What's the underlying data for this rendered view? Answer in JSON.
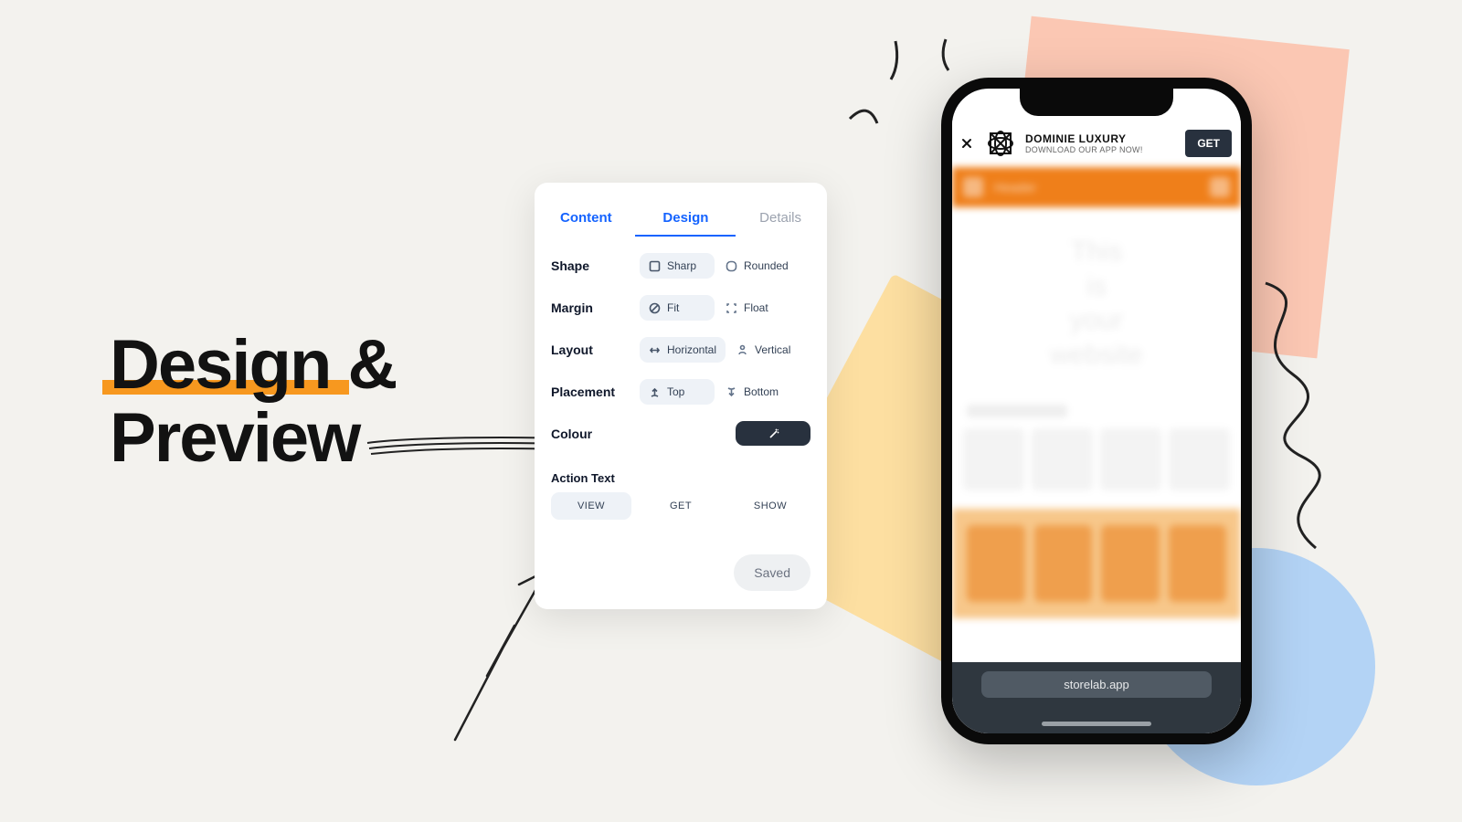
{
  "title": {
    "line1": "Design &",
    "line2": "Preview"
  },
  "panel": {
    "tabs": {
      "content": "Content",
      "design": "Design",
      "details": "Details"
    },
    "rows": {
      "shape": {
        "label": "Shape",
        "a": "Sharp",
        "b": "Rounded"
      },
      "margin": {
        "label": "Margin",
        "a": "Fit",
        "b": "Float"
      },
      "layout": {
        "label": "Layout",
        "a": "Horizontal",
        "b": "Vertical"
      },
      "placement": {
        "label": "Placement",
        "a": "Top",
        "b": "Bottom"
      },
      "colour": {
        "label": "Colour"
      }
    },
    "action_text": {
      "label": "Action Text",
      "options": {
        "view": "VIEW",
        "get": "GET",
        "show": "SHOW"
      }
    },
    "save_button": "Saved"
  },
  "phone": {
    "banner": {
      "title": "DOMINIE LUXURY",
      "subtitle": "DOWNLOAD OUR APP NOW!",
      "cta": "GET"
    },
    "hero": {
      "l1": "This",
      "l2": "is",
      "l3": "your",
      "l4": "website"
    },
    "url": "storelab.app"
  },
  "site_header_placeholder": "Header"
}
